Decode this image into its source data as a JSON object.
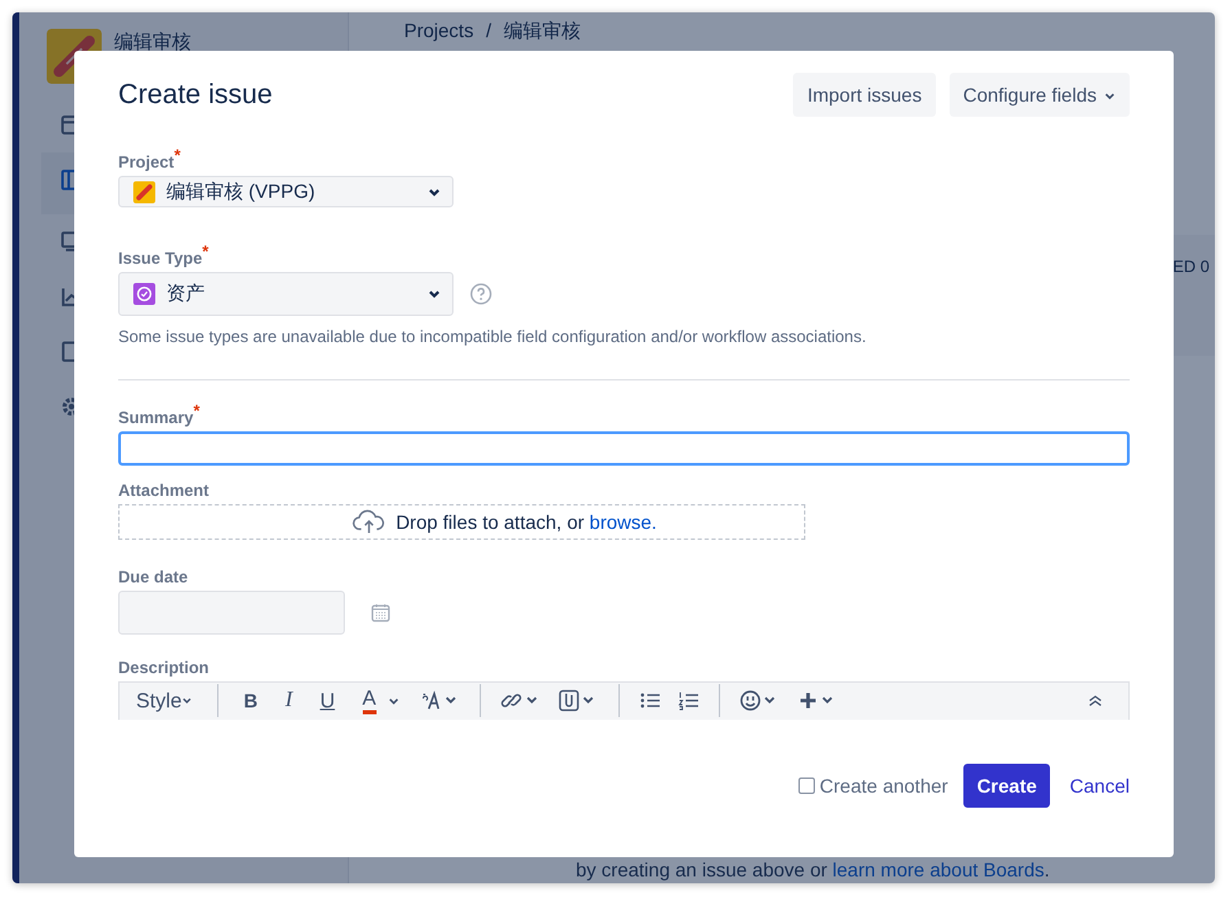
{
  "background": {
    "project_name": "编辑审核",
    "breadcrumb": [
      "Projects",
      "编辑审核"
    ],
    "breadcrumb_separator": "/",
    "column_count": "ED 0",
    "hint": {
      "text": "by creating an issue above or ",
      "link": "learn more about Boards",
      "end": "."
    }
  },
  "dialog": {
    "title": "Create issue",
    "header_buttons": [
      {
        "label": "Import issues",
        "dropdown": false
      },
      {
        "label": "Configure fields",
        "dropdown": true
      }
    ],
    "project": {
      "label": "Project",
      "required_mark": "*",
      "value": "编辑审核 (VPPG)"
    },
    "issue_type": {
      "label": "Issue Type",
      "required_mark": "*",
      "value": "资产",
      "help": "Some issue types are unavailable due to incompatible field configuration and/or workflow associations."
    },
    "summary": {
      "label": "Summary",
      "required_mark": "*",
      "focused": true
    },
    "attachment": {
      "label": "Attachment",
      "text": "Drop files to attach, or ",
      "link": "browse."
    },
    "due_date": {
      "label": "Due date"
    },
    "description": {
      "label": "Description",
      "toolbar": {
        "style": "Style",
        "bold": "B",
        "italic": "I",
        "underline": "U",
        "text_color": "A"
      }
    },
    "create_another": {
      "label": "Create another",
      "checked": false
    },
    "buttons": [
      {
        "label": "Create",
        "kind": "primary"
      },
      {
        "label": "Cancel",
        "kind": "link"
      }
    ]
  }
}
